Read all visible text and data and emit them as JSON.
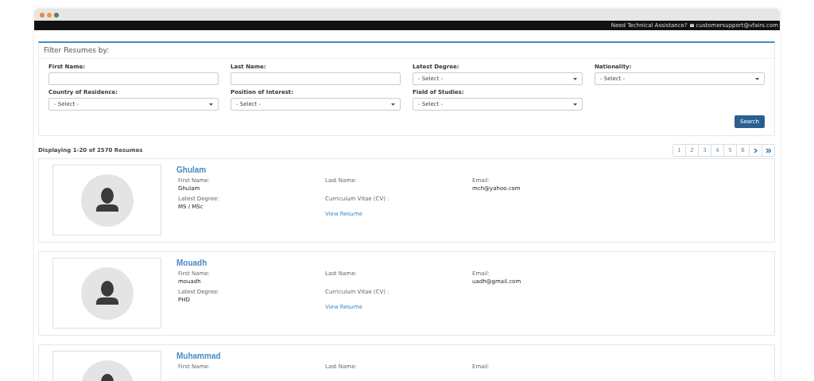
{
  "top_bar": {
    "help_text": "Need Technical Assistance?",
    "email": "customersupport@vfairs.com"
  },
  "filter": {
    "title": "Filter Resumes by:",
    "fields": [
      {
        "kind": "text",
        "label": "First Name:"
      },
      {
        "kind": "text",
        "label": "Last Name:"
      },
      {
        "kind": "select",
        "label": "Latest Degree:",
        "value": "- Select -"
      },
      {
        "kind": "select",
        "label": "Nationality:",
        "value": "- Select -"
      },
      {
        "kind": "select",
        "label": "Country of Residence:",
        "value": "- Select -"
      },
      {
        "kind": "select",
        "label": "Position of Interest:",
        "value": "- Select -"
      },
      {
        "kind": "select",
        "label": "Field of Studies:",
        "value": "- Select -"
      }
    ],
    "search_button": "Search"
  },
  "results_summary": "Displaying 1-20 of 2570 Resumes",
  "pagination": [
    "1",
    "2",
    "3",
    "4",
    "5",
    "6"
  ],
  "resumes": [
    {
      "name": "Ghulam",
      "first_name_label": "First Name:",
      "first_name": "Ghulam",
      "last_name_label": "Last Name:",
      "email_label": "Email:",
      "email": "mch@yahoo.com",
      "degree_label": "Latest Degree:",
      "degree": "MS / MSc",
      "cv_label": "Curriculum Vitae (CV) :",
      "cv_link": "View Resume"
    },
    {
      "name": "Mouadh",
      "first_name_label": "First Name:",
      "first_name": "mouadh",
      "last_name_label": "Last Name:",
      "email_label": "Email:",
      "email": "uadh@gmail.com",
      "degree_label": "Latest Degree:",
      "degree": "PHD",
      "cv_label": "Curriculum Vitae (CV) :",
      "cv_link": "View Resume"
    },
    {
      "name": "Muhammad",
      "first_name_label": "First Name:",
      "last_name_label": "Last Name:",
      "email_label": "Email:"
    }
  ]
}
